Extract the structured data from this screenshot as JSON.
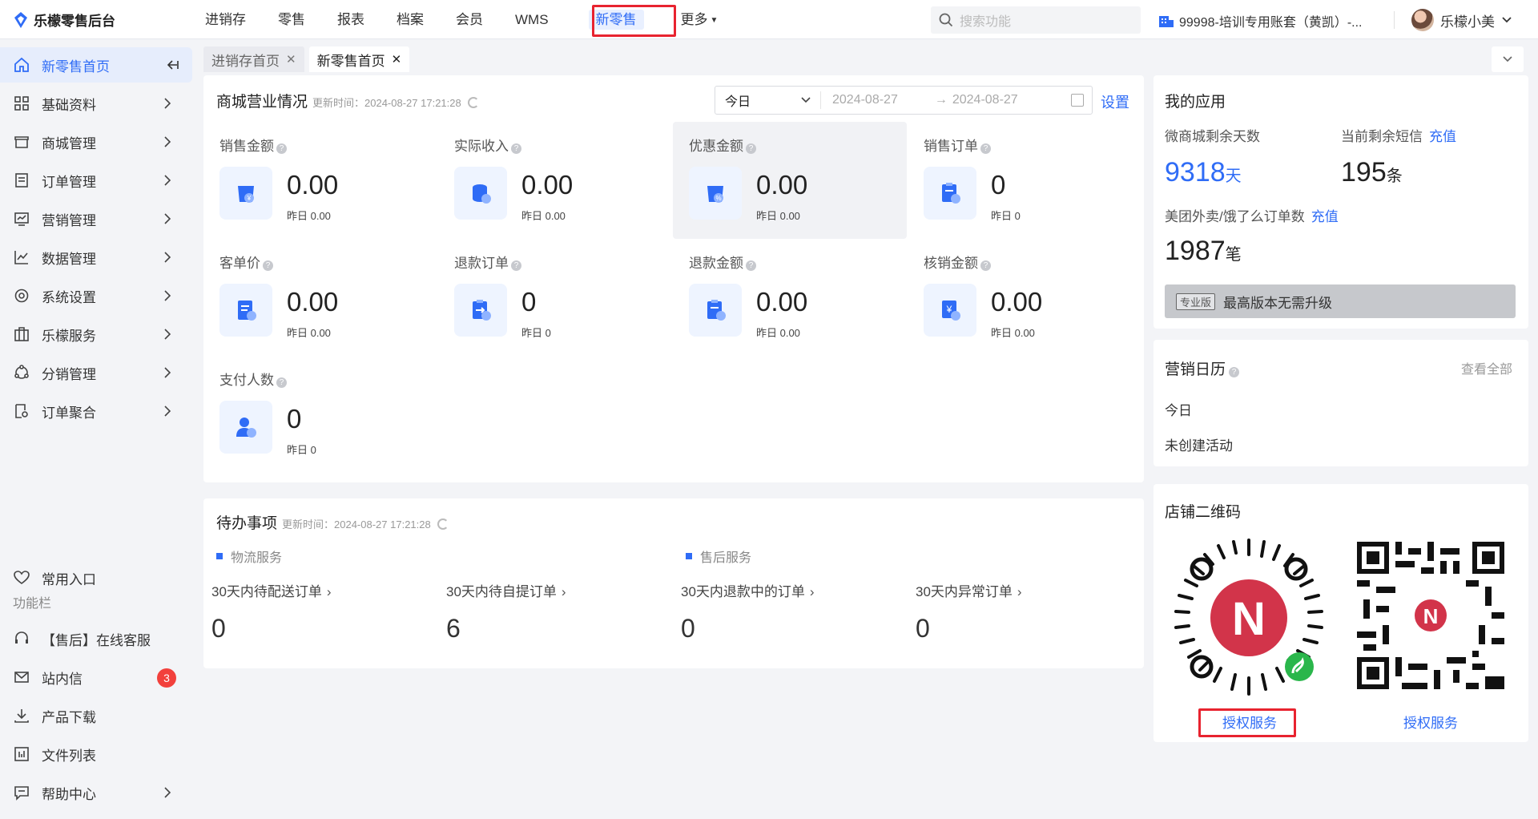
{
  "app": {
    "title": "乐檬零售后台"
  },
  "nav": {
    "items": [
      "进销存",
      "零售",
      "报表",
      "档案",
      "会员",
      "WMS",
      "新零售",
      "更多"
    ],
    "search_placeholder": "搜索功能",
    "account": "99998-培训专用账套（黄凯）-...",
    "user": "乐檬小美"
  },
  "sidebar": {
    "items": [
      "新零售首页",
      "基础资料",
      "商城管理",
      "订单管理",
      "营销管理",
      "数据管理",
      "系统设置",
      "乐檬服务",
      "分销管理",
      "订单聚合"
    ],
    "common_entry": "常用入口",
    "section_label": "功能栏",
    "func_items": [
      "【售后】在线客服",
      "站内信",
      "产品下载",
      "文件列表",
      "帮助中心"
    ],
    "message_count": "3"
  },
  "tabs": [
    "进销存首页",
    "新零售首页"
  ],
  "overview": {
    "title": "商城营业情况",
    "update_time": "更新时间：2024-08-27 17:21:28",
    "period": "今日",
    "date_start": "2024-08-27",
    "date_end": "2024-08-27",
    "settings": "设置",
    "metrics": [
      {
        "label": "销售金额",
        "value": "0.00",
        "yesterday": "昨日 0.00"
      },
      {
        "label": "实际收入",
        "value": "0.00",
        "yesterday": "昨日 0.00"
      },
      {
        "label": "优惠金额",
        "value": "0.00",
        "yesterday": "昨日 0.00"
      },
      {
        "label": "销售订单",
        "value": "0",
        "yesterday": "昨日 0"
      },
      {
        "label": "客单价",
        "value": "0.00",
        "yesterday": "昨日 0.00"
      },
      {
        "label": "退款订单",
        "value": "0",
        "yesterday": "昨日 0"
      },
      {
        "label": "退款金额",
        "value": "0.00",
        "yesterday": "昨日 0.00"
      },
      {
        "label": "核销金额",
        "value": "0.00",
        "yesterday": "昨日 0.00"
      },
      {
        "label": "支付人数",
        "value": "0",
        "yesterday": "昨日 0"
      }
    ]
  },
  "todo": {
    "title": "待办事项",
    "update_time": "更新时间：2024-08-27 17:21:28",
    "groups": [
      "物流服务",
      "售后服务"
    ],
    "items": [
      {
        "label": "30天内待配送订单",
        "value": "0"
      },
      {
        "label": "30天内待自提订单",
        "value": "6"
      },
      {
        "label": "30天内退款中的订单",
        "value": "0"
      },
      {
        "label": "30天内异常订单",
        "value": "0"
      }
    ]
  },
  "my_apps": {
    "title": "我的应用",
    "days_label": "微商城剩余天数",
    "days_value": "9318",
    "days_unit": "天",
    "sms_label": "当前剩余短信",
    "sms_recharge": "充值",
    "sms_value": "195",
    "sms_unit": "条",
    "takeout_label": "美团外卖/饿了么订单数",
    "takeout_recharge": "充值",
    "takeout_value": "1987",
    "takeout_unit": "笔",
    "edition_tag": "专业版",
    "edition_text": "最高版本无需升级"
  },
  "calendar": {
    "title": "营销日历",
    "view_all": "查看全部",
    "today": "今日",
    "empty": "未创建活动"
  },
  "qr": {
    "title": "店铺二维码",
    "left_link": "授权服务",
    "right_link": "授权服务"
  },
  "colors": {
    "accent": "#2f6cf6",
    "highlight_border": "#e8232f"
  }
}
